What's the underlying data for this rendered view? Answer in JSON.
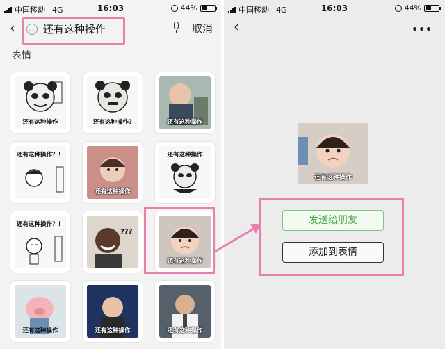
{
  "colors": {
    "highlight": "#e97fae",
    "send_button_text": "#4ba84b"
  },
  "left_screen": {
    "status_bar": {
      "carrier": "中国移动",
      "network": "4G",
      "time": "16:03",
      "battery": "44%",
      "battery_level": 0.44
    },
    "header": {
      "back_icon": "chevron-left-icon",
      "search_icon": "smile-icon",
      "search_text": "还有这种操作",
      "mic_icon": "mic-icon",
      "cancel_label": "取消"
    },
    "section_title": "表情",
    "stickers": [
      {
        "caption": "还有这种操作"
      },
      {
        "caption": "还有这种操作?"
      },
      {
        "caption": "还有这种操作"
      },
      {
        "caption": "还有这种操作？！"
      },
      {
        "caption": "还有这种操作"
      },
      {
        "caption": "还有这种操作"
      },
      {
        "caption": "还有这种操作？！"
      },
      {
        "caption": "???"
      },
      {
        "caption": "还有这种操作"
      },
      {
        "caption": "还有这种操作"
      },
      {
        "caption": "还有这种操作"
      },
      {
        "caption": "还有这种操作"
      }
    ]
  },
  "right_screen": {
    "status_bar": {
      "carrier": "中国移动",
      "network": "4G",
      "time": "16:03",
      "battery": "44%",
      "battery_level": 0.44
    },
    "header": {
      "back_icon": "chevron-left-icon",
      "more_label": "•••"
    },
    "sticker_caption": "还有这种操作",
    "send_button": "发送给朋友",
    "add_button": "添加到表情"
  }
}
